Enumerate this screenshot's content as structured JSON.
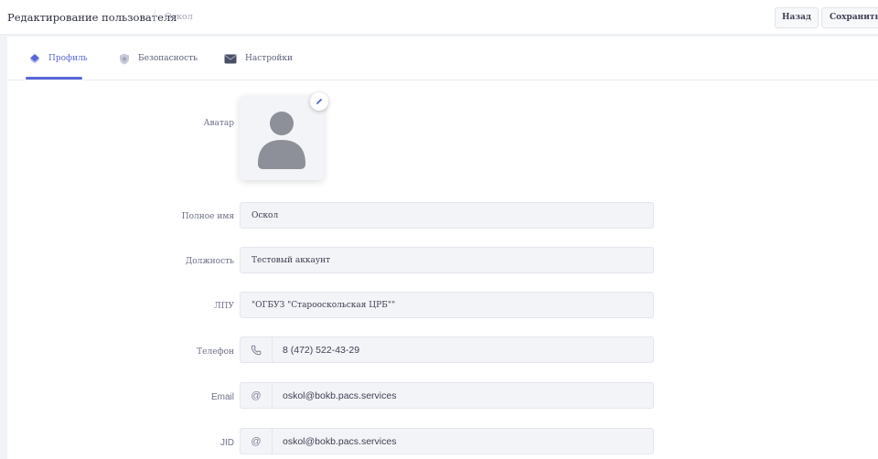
{
  "header": {
    "title": "Редактирование пользователя",
    "breadcrumb": "Оскол",
    "back_label": "Назад",
    "save_label": "Сохранить"
  },
  "tabs": [
    {
      "label": "Профиль",
      "icon": "diamond-icon",
      "active": true
    },
    {
      "label": "Безопасность",
      "icon": "shield-icon",
      "active": false
    },
    {
      "label": "Настройки",
      "icon": "envelope-icon",
      "active": false
    }
  ],
  "form": {
    "avatar_label": "Аватар",
    "full_name_label": "Полное имя",
    "full_name_value": "Оскол",
    "position_label": "Должность",
    "position_value": "Тестовый аккаунт",
    "lpu_label": "ЛПУ",
    "lpu_value": "\"ОГБУЗ \"Старооскольская ЦРБ\"\"",
    "phone_label": "Телефон",
    "phone_value": "8 (472) 522-43-29",
    "phone_addon": "phone-icon",
    "email_label": "Email",
    "email_value": "oskol@bokb.pacs.services",
    "email_addon": "@",
    "jid_label": "JID",
    "jid_value": "oskol@bokb.pacs.services",
    "jid_addon": "@"
  },
  "colors": {
    "accent": "#5a67d8",
    "avatar_silhouette": "#8d8f99",
    "page_bg": "#f2f3f7",
    "input_bg": "#f3f4f7"
  }
}
